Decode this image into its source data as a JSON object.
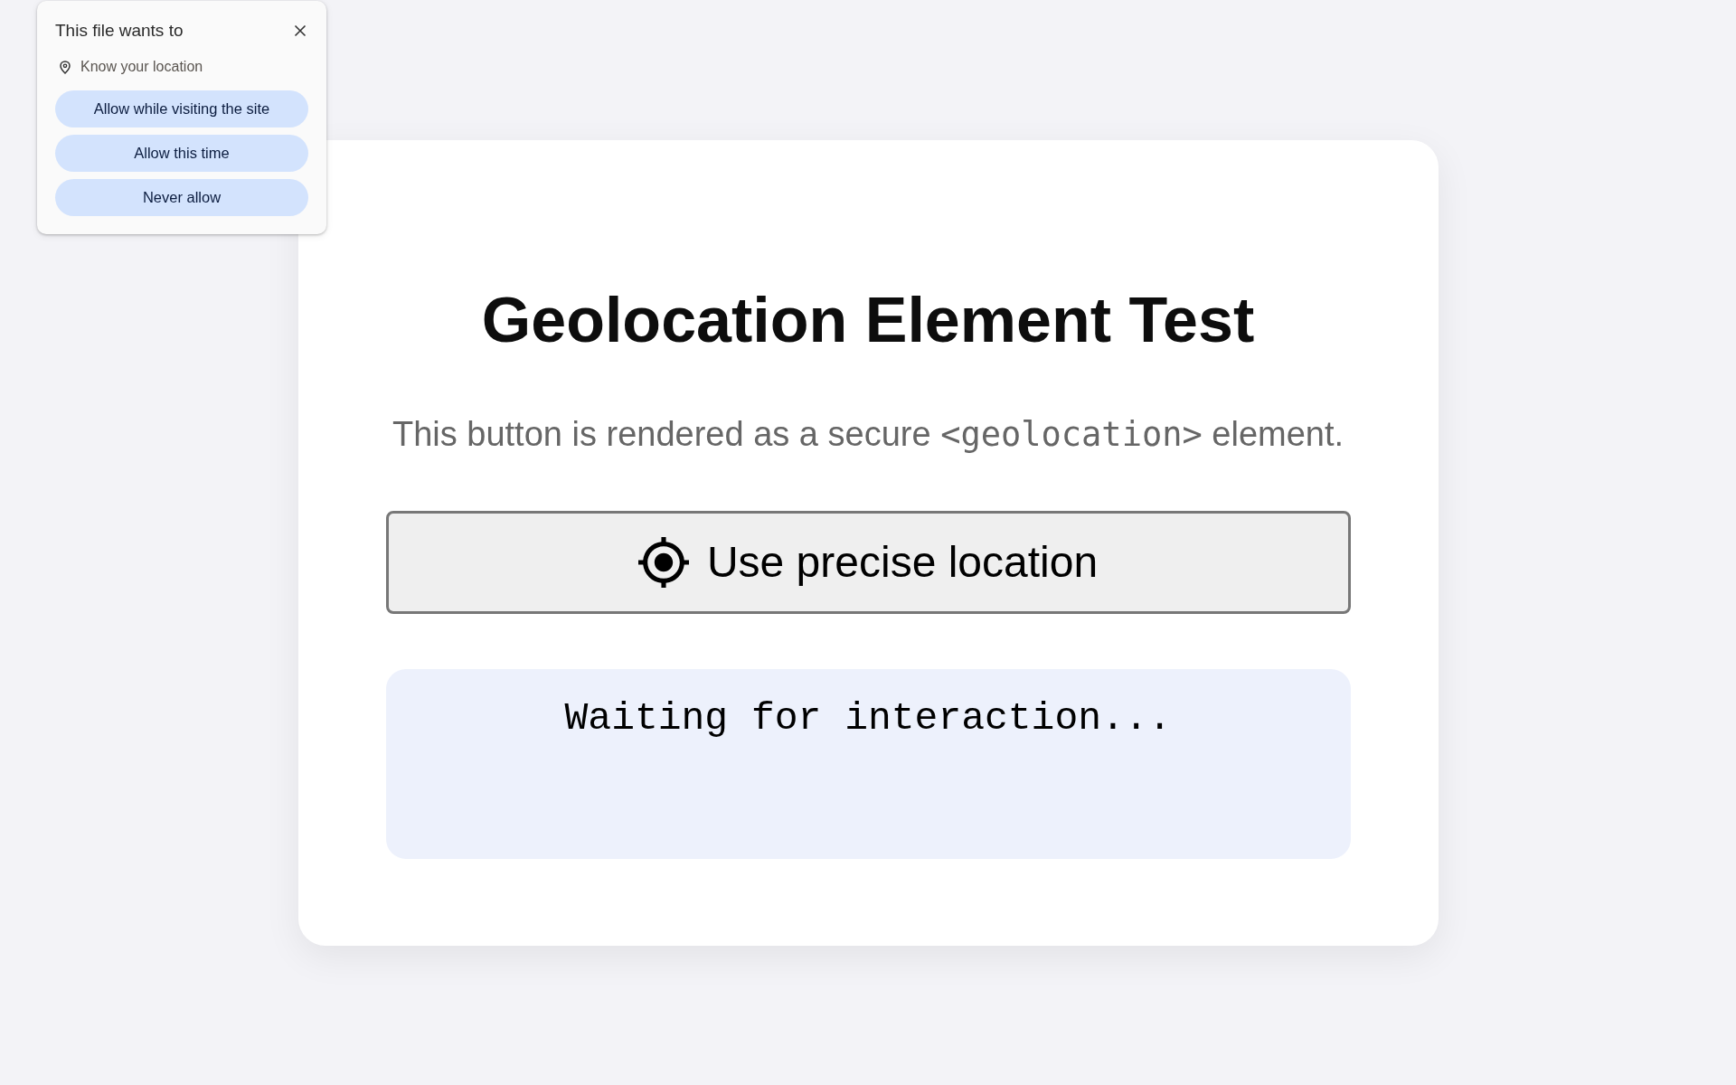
{
  "permission_prompt": {
    "title": "This file wants to",
    "permission": "Know your location",
    "buttons": [
      "Allow while visiting the site",
      "Allow this time",
      "Never allow"
    ]
  },
  "card": {
    "title": "Geolocation Element Test",
    "description": [
      {
        "kind": "text",
        "text": "This button is rendered as a secure "
      },
      {
        "kind": "code",
        "text": "<geolocation>"
      },
      {
        "kind": "text",
        "text": " element."
      }
    ],
    "geolocation_button": {
      "label": "Use precise location"
    },
    "status": {
      "text": "Waiting for interaction..."
    }
  }
}
